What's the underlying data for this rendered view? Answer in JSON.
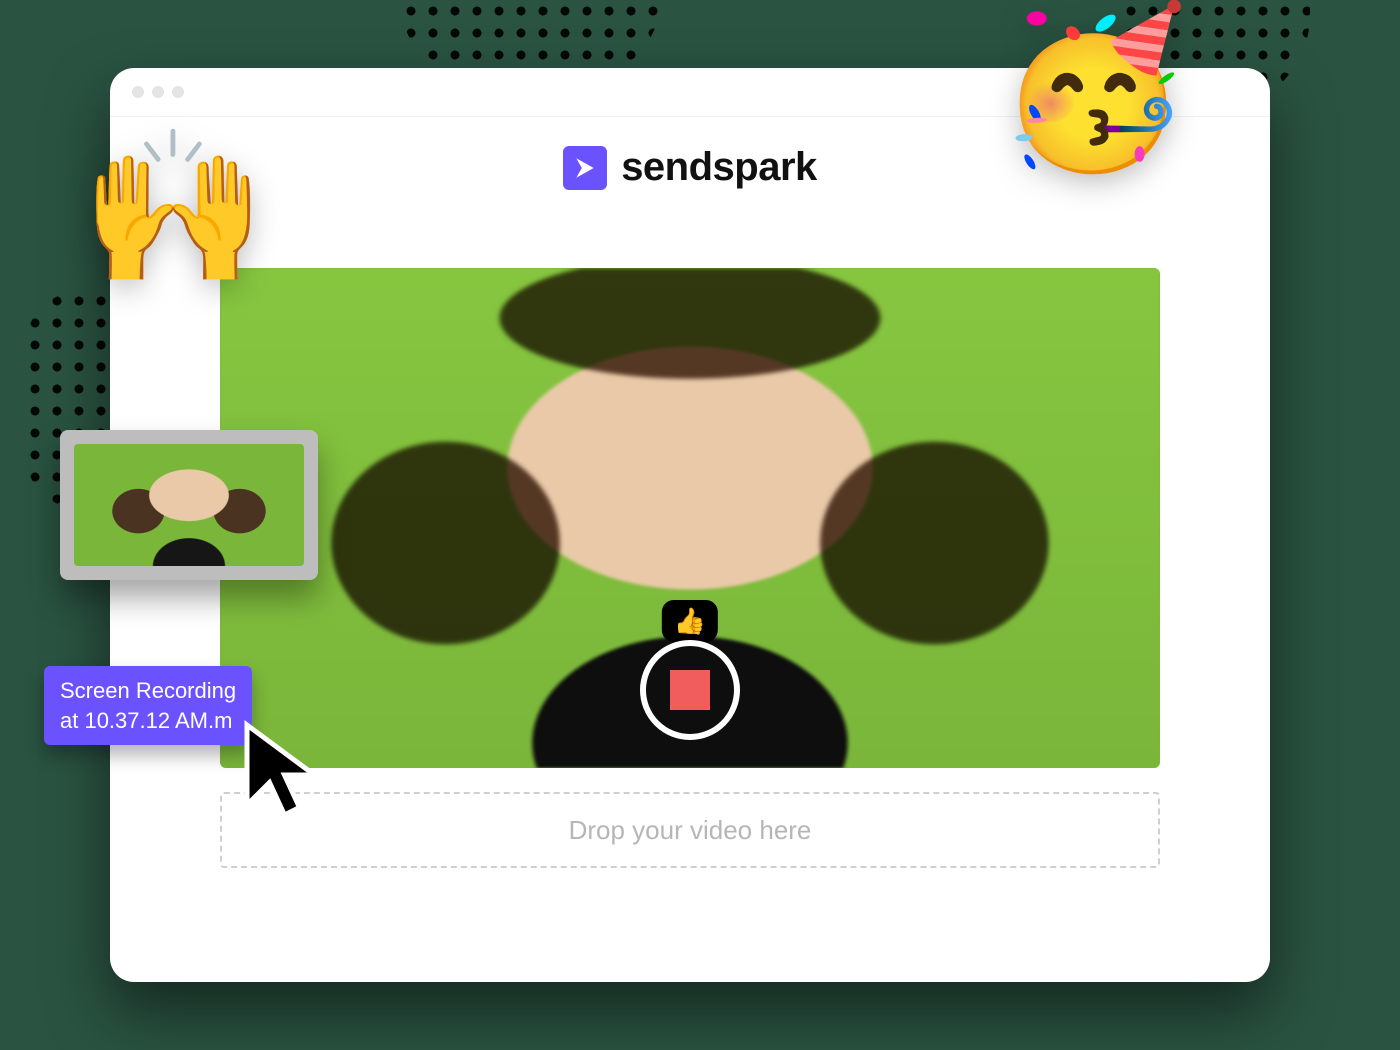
{
  "brand": {
    "name": "sendspark"
  },
  "video": {
    "tooltip_emoji": "👍",
    "record_button_label": "Stop recording"
  },
  "dropzone": {
    "prompt": "Drop your video here"
  },
  "dragged_file": {
    "name": "Screen Recording\nat 10.37.12 AM.m"
  },
  "decor": {
    "emoji_hands": "🙌",
    "emoji_party": "🥳"
  },
  "colors": {
    "accent": "#6b52ff"
  }
}
